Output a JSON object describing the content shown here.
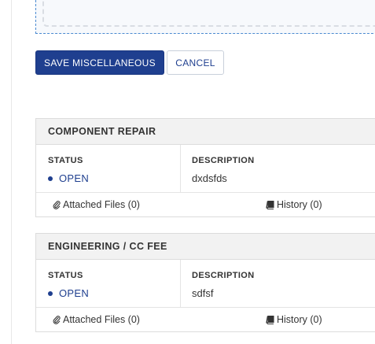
{
  "actions": {
    "save_label": "SAVE MISCELLANEOUS",
    "cancel_label": "CANCEL"
  },
  "colors": {
    "primary": "#1f3f8f",
    "header_bg": "#f2f2f2",
    "border": "#dcdcdc"
  },
  "cards": [
    {
      "title": "COMPONENT REPAIR",
      "status_label": "STATUS",
      "status_value": "OPEN",
      "description_label": "DESCRIPTION",
      "description_value": "dxdsfds",
      "attached_files": "Attached Files (0)",
      "history": "History (0)"
    },
    {
      "title": "ENGINEERING / CC FEE",
      "status_label": "STATUS",
      "status_value": "OPEN",
      "description_label": "DESCRIPTION",
      "description_value": "sdfsf",
      "attached_files": "Attached Files (0)",
      "history": "History (0)"
    }
  ],
  "icons": {
    "attachment": "paperclip-icon",
    "history": "book-icon",
    "status": "dot-icon"
  }
}
